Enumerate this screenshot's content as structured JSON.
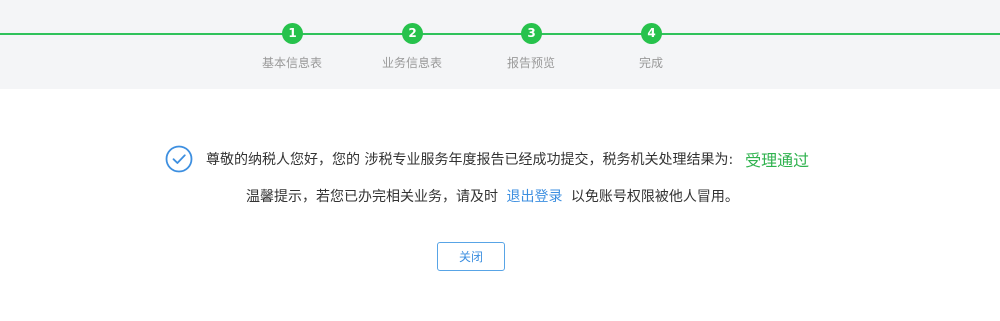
{
  "steps": [
    {
      "number": "1",
      "label": "基本信息表"
    },
    {
      "number": "2",
      "label": "业务信息表"
    },
    {
      "number": "3",
      "label": "报告预览"
    },
    {
      "number": "4",
      "label": "完成"
    }
  ],
  "result": {
    "message": "尊敬的纳税人您好，您的 涉税专业服务年度报告已经成功提交，税务机关处理结果为:",
    "status": "受理通过",
    "status_color": "#2fb24e",
    "icon": "check-circle-icon"
  },
  "tip": {
    "prefix": "温馨提示，若您已办完相关业务，请及时",
    "link": "退出登录",
    "suffix": "以免账号权限被他人冒用。"
  },
  "close_button": {
    "label": "关闭"
  },
  "colors": {
    "accent_green": "#27c24c",
    "link_blue": "#3d8fe0",
    "header_bg": "#f4f5f7"
  }
}
